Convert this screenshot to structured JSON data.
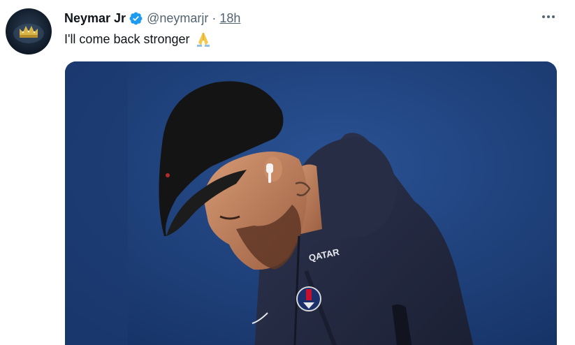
{
  "tweet": {
    "author": {
      "display_name": "Neymar Jr",
      "handle": "@neymarjr",
      "verified": true,
      "avatar_icon": "crown-avatar"
    },
    "separator": "·",
    "timestamp": "18h",
    "text": "I'll come back stronger",
    "emoji_icon": "folded-hands-emoji",
    "more_icon": "more-horizontal-icon",
    "media": {
      "type": "photo",
      "icon": "photo-player-in-cap-and-hoodie",
      "jersey_text": "QATAR"
    }
  },
  "colors": {
    "text_primary": "#0f1419",
    "text_secondary": "#536471",
    "verified_blue": "#1d9bf0",
    "photo_background": "#1e3f78"
  }
}
